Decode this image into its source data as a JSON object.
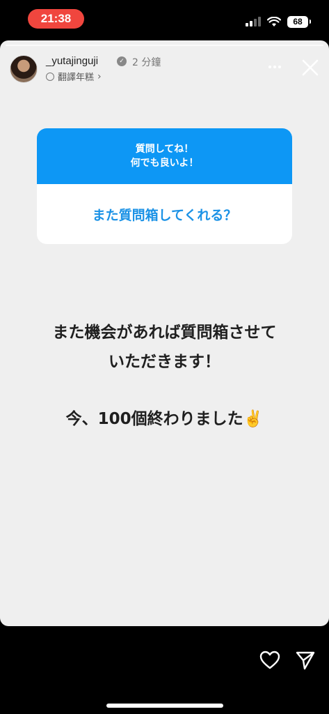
{
  "status_bar": {
    "time": "21:38",
    "battery": "68"
  },
  "story": {
    "username": "_yutajinguji",
    "time_ago": "2 分鐘",
    "translate_label": "翻譯年糕",
    "question_sticker": {
      "prompt_line1": "質問してね！",
      "prompt_line2": "何でも良いよ！",
      "answer": "また質問箱してくれる？"
    },
    "body_line1": "また機会があれば質問箱させて",
    "body_line2": "いただきます！",
    "body_line3": "今、100個終わりました✌️"
  },
  "icons": [
    "signal-icon",
    "wifi-icon",
    "battery-icon",
    "verified-badge-icon",
    "translate-icon",
    "chevron-right-icon",
    "more-icon",
    "close-icon",
    "heart-icon",
    "share-icon"
  ]
}
